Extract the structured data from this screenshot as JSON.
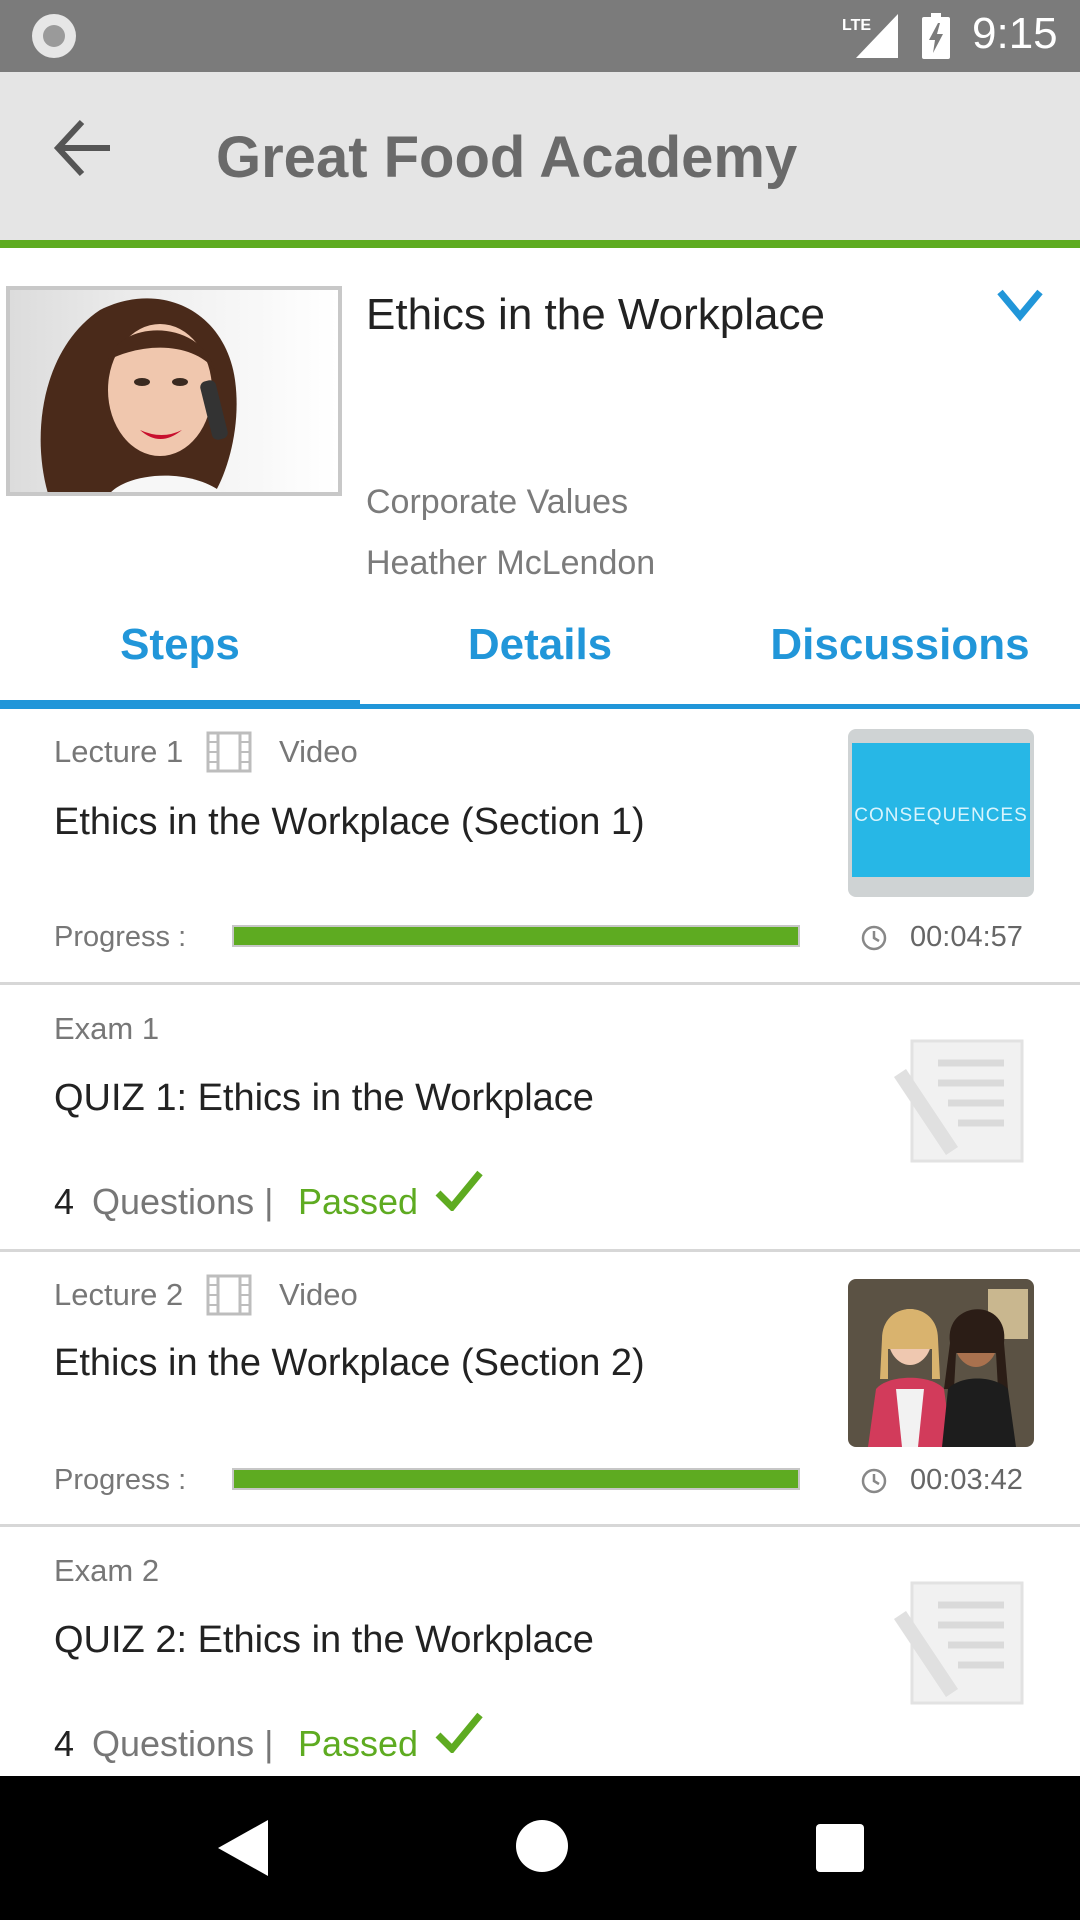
{
  "status_bar": {
    "time": "9:15",
    "network": "LTE"
  },
  "app_bar": {
    "title": "Great Food Academy",
    "back_icon": "arrow-left-icon"
  },
  "course": {
    "title": "Ethics in the Workplace",
    "category": "Corporate Values",
    "author": "Heather McLendon",
    "expand_icon": "chevron-down-icon"
  },
  "tabs": [
    {
      "label": "Steps",
      "active": true
    },
    {
      "label": "Details",
      "active": false
    },
    {
      "label": "Discussions",
      "active": false
    }
  ],
  "steps": [
    {
      "kind": "Lecture 1",
      "media": "Video",
      "title": "Ethics in the Workplace (Section 1)",
      "progress_label": "Progress :",
      "progress": 1.0,
      "duration": "00:04:57",
      "thumb_text": "CONSEQUENCES"
    },
    {
      "kind": "Exam 1",
      "title": "QUIZ 1: Ethics in the Workplace",
      "question_count": "4",
      "questions_label": "Questions |",
      "status": "Passed"
    },
    {
      "kind": "Lecture 2",
      "media": "Video",
      "title": "Ethics in the Workplace (Section 2)",
      "progress_label": "Progress :",
      "progress": 1.0,
      "duration": "00:03:42"
    },
    {
      "kind": "Exam 2",
      "title": "QUIZ 2: Ethics in the Workplace",
      "question_count": "4",
      "questions_label": "Questions |",
      "status": "Passed"
    }
  ],
  "colors": {
    "accent": "#2196d9",
    "success": "#5eab21",
    "app_bar_bg": "#e5e5e5",
    "status_bar_bg": "#7b7b7b"
  }
}
